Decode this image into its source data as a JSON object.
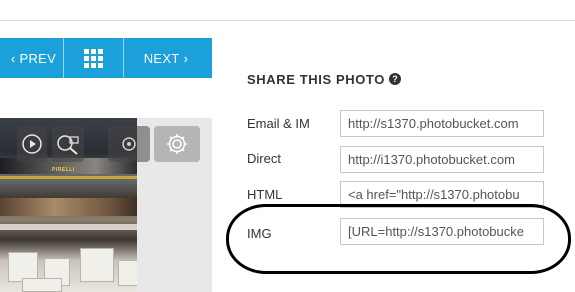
{
  "nav": {
    "prev_label": "PREV",
    "next_label": "NEXT",
    "prev_icon": "chevron-left-icon",
    "grid_icon": "grid-icon",
    "next_icon": "chevron-right-icon"
  },
  "photo": {
    "sign_text": "PIRELLI",
    "controls": [
      "play-icon",
      "zoom-icon",
      "share-icon",
      "gear-icon"
    ]
  },
  "share": {
    "title": "SHARE THIS PHOTO",
    "help_icon": "help-icon",
    "rows": [
      {
        "label": "Email & IM",
        "value": "http://s1370.photobucket.com"
      },
      {
        "label": "Direct",
        "value": "http://i1370.photobucket.com"
      },
      {
        "label": "HTML",
        "value": "<a href=\"http://s1370.photobu"
      },
      {
        "label": "IMG",
        "value": "[URL=http://s1370.photobucke"
      }
    ]
  },
  "colors": {
    "nav_background": "#1ca0dc",
    "annotation": "#000000"
  }
}
